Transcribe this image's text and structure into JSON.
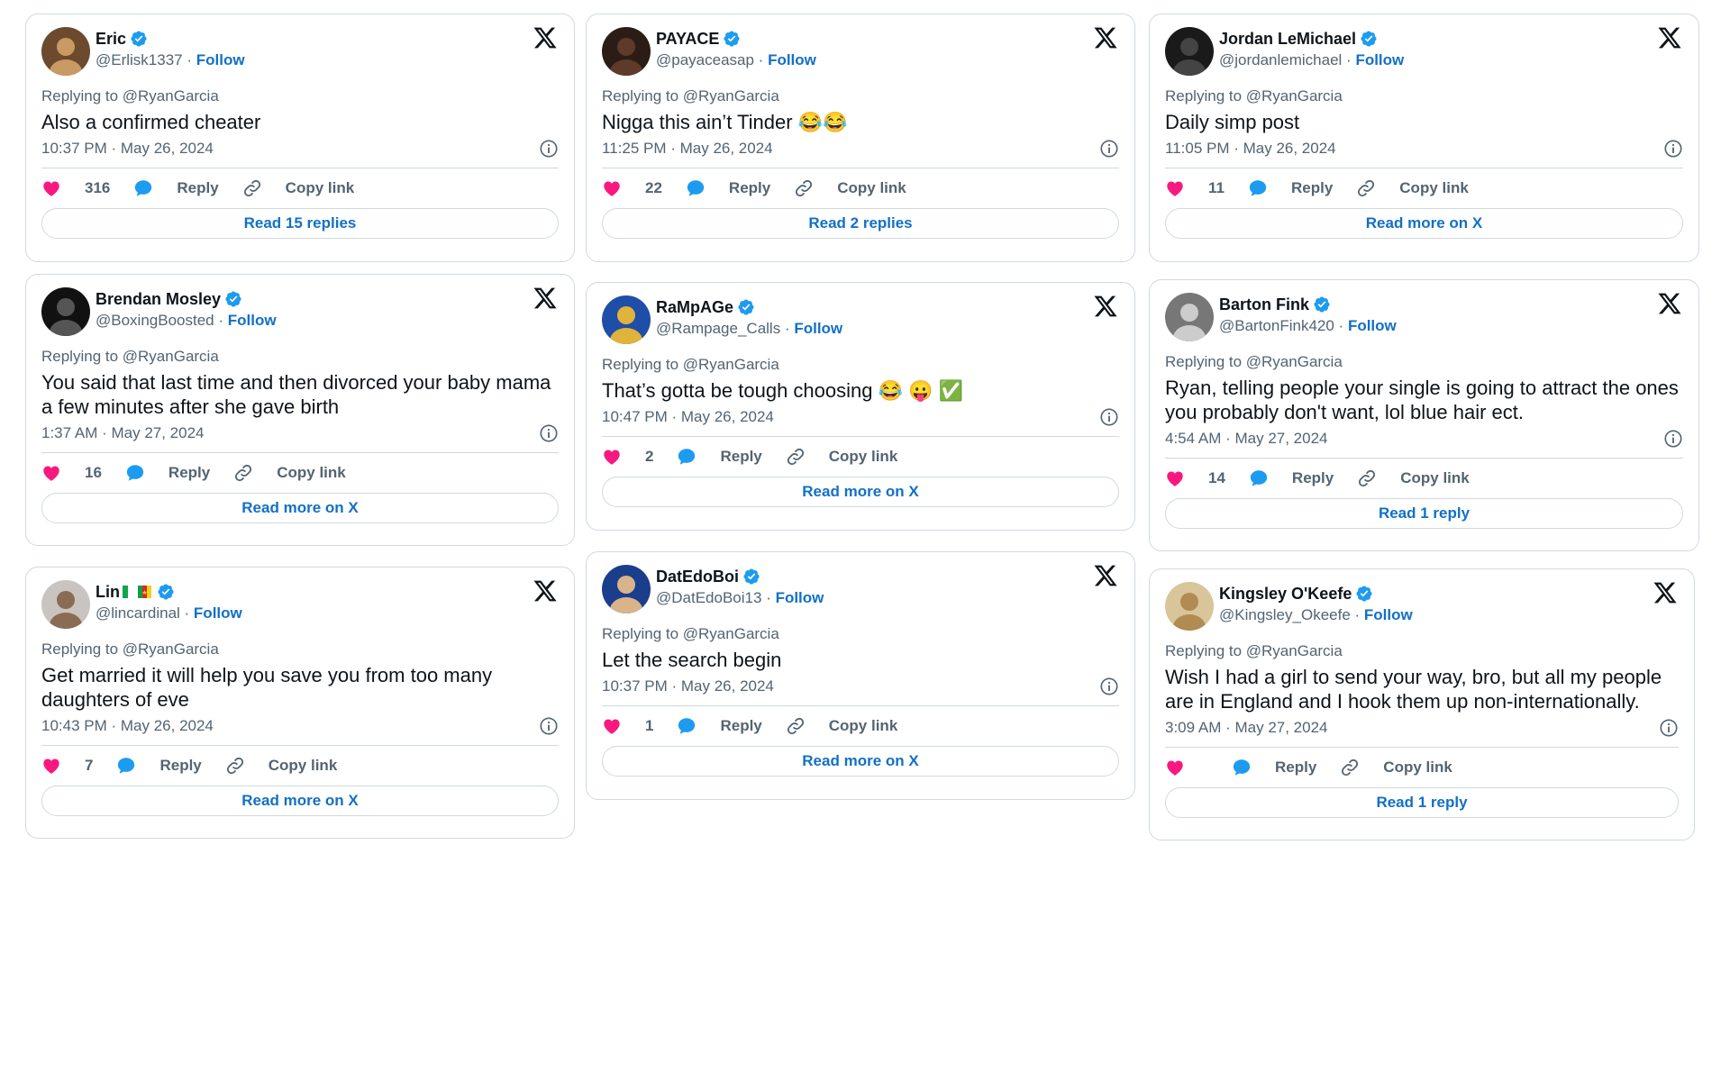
{
  "colors": {
    "link": "#1270c5",
    "secondary_text": "#536471",
    "border": "#cfd9de",
    "heart": "#f91880",
    "reply_bubble": "#1d9bf0",
    "verified": "#1d9bf0"
  },
  "common": {
    "follow_label": "Follow",
    "reply_label": "Reply",
    "copy_link_label": "Copy link",
    "separator": " · "
  },
  "tweets": [
    {
      "name": "Eric",
      "handle": "@Erlisk1337",
      "replying": "Replying to @RyanGarcia",
      "text": "Also a confirmed cheater",
      "time": "10:37 PM · May 26, 2024",
      "likes": "316",
      "read_button": "Read 15 replies"
    },
    {
      "name": "PAYACE",
      "handle": "@payaceasap",
      "replying": "Replying to @RyanGarcia",
      "text": "Nigga this ain’t Tinder 😂😂",
      "time": "11:25 PM · May 26, 2024",
      "likes": "22",
      "read_button": "Read 2 replies"
    },
    {
      "name": "Jordan LeMichael",
      "handle": "@jordanlemichael",
      "replying": "Replying to @RyanGarcia",
      "text": "Daily simp post",
      "time": "11:05 PM · May 26, 2024",
      "likes": "11",
      "read_button": "Read more on X"
    },
    {
      "name": "Brendan Mosley",
      "handle": "@BoxingBoosted",
      "replying": "Replying to @RyanGarcia",
      "text": "You said that last time and then divorced your baby mama a few minutes after she gave birth",
      "time": "1:37 AM · May 27, 2024",
      "likes": "16",
      "read_button": "Read more on X"
    },
    {
      "name": "RaMpAGe",
      "handle": "@Rampage_Calls",
      "replying": "Replying to @RyanGarcia",
      "text": "That’s gotta be tough choosing 😂 😛 ✅",
      "time": "10:47 PM · May 26, 2024",
      "likes": "2",
      "read_button": "Read more on X"
    },
    {
      "name": "Barton Fink",
      "handle": "@BartonFink420",
      "replying": "Replying to @RyanGarcia",
      "text": "Ryan, telling people your single is going to attract the ones you probably don't want, lol blue hair ect.",
      "time": "4:54 AM · May 27, 2024",
      "likes": "14",
      "read_button": "Read 1 reply"
    },
    {
      "name": "Lin",
      "handle": "@lincardinal",
      "flag": "cameroon-flag-icon",
      "replying": "Replying to @RyanGarcia",
      "text": "Get married it will help you save you from too many daughters of eve",
      "time": "10:43 PM · May 26, 2024",
      "likes": "7",
      "read_button": "Read more on X"
    },
    {
      "name": "DatEdoBoi",
      "handle": "@DatEdoBoi13",
      "replying": "Replying to @RyanGarcia",
      "text": "Let the search begin",
      "time": "10:37 PM · May 26, 2024",
      "likes": "1",
      "read_button": "Read more on X"
    },
    {
      "name": "Kingsley O'Keefe",
      "handle": "@Kingsley_Okeefe",
      "replying": "Replying to @RyanGarcia",
      "text": "Wish I had a girl to send your way, bro, but all my people are in England and I hook them up non-internationally.",
      "time": "3:09 AM · May 27, 2024",
      "likes": "",
      "read_button": "Read 1 reply"
    }
  ]
}
